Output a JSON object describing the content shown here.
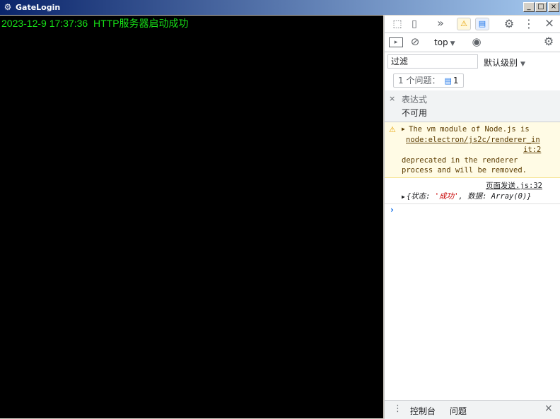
{
  "window": {
    "title": "GateLogin",
    "minimize": "_",
    "maximize": "□",
    "close": "×",
    "app_icon": "⚙"
  },
  "console": {
    "line": "2023-12-9 17:37:36  HTTP服务器启动成功",
    "text_color": "#17e017",
    "background": "#000000"
  },
  "devtools": {
    "tabbar": {
      "inspect_icon": "⬚",
      "device_icon": "▯",
      "more_tabs_icon": "»",
      "warn_badge": "⚠",
      "info_badge": "▤",
      "settings_icon": "⚙",
      "menu_icon": "⋮",
      "close_icon": "×"
    },
    "toolbar": {
      "sidebar_icon": "▸",
      "clear_icon": "⊘",
      "context": "top",
      "dropdown_arrow": "▼",
      "eye_icon": "◉",
      "settings_icon": "⚙"
    },
    "filter": {
      "placeholder": "过滤",
      "levels": "默认级别",
      "levels_arrow": "▼"
    },
    "issues": {
      "label": "1 个问题：",
      "icon": "▤",
      "count": "1"
    },
    "expression": {
      "close": "×",
      "label": "表达式",
      "value": "不可用"
    },
    "warning": {
      "icon": "⚠",
      "triangle": "▶",
      "line1": "The vm module of Node.js is",
      "link_part1": "node:electron/js2c/renderer_in",
      "link_part2": "it:2",
      "line3": "deprecated in the renderer",
      "line4": "process and will be removed."
    },
    "log": {
      "source": "页面发送.js:32",
      "triangle": "▶",
      "obj_open": "{状态: ",
      "obj_str": "'成功'",
      "obj_rest": ", 数据: Array(0)}"
    },
    "prompt": "›",
    "drawer": {
      "dots": "⋮",
      "tab_console": "控制台",
      "tab_issues": "问题",
      "close": "×"
    }
  }
}
